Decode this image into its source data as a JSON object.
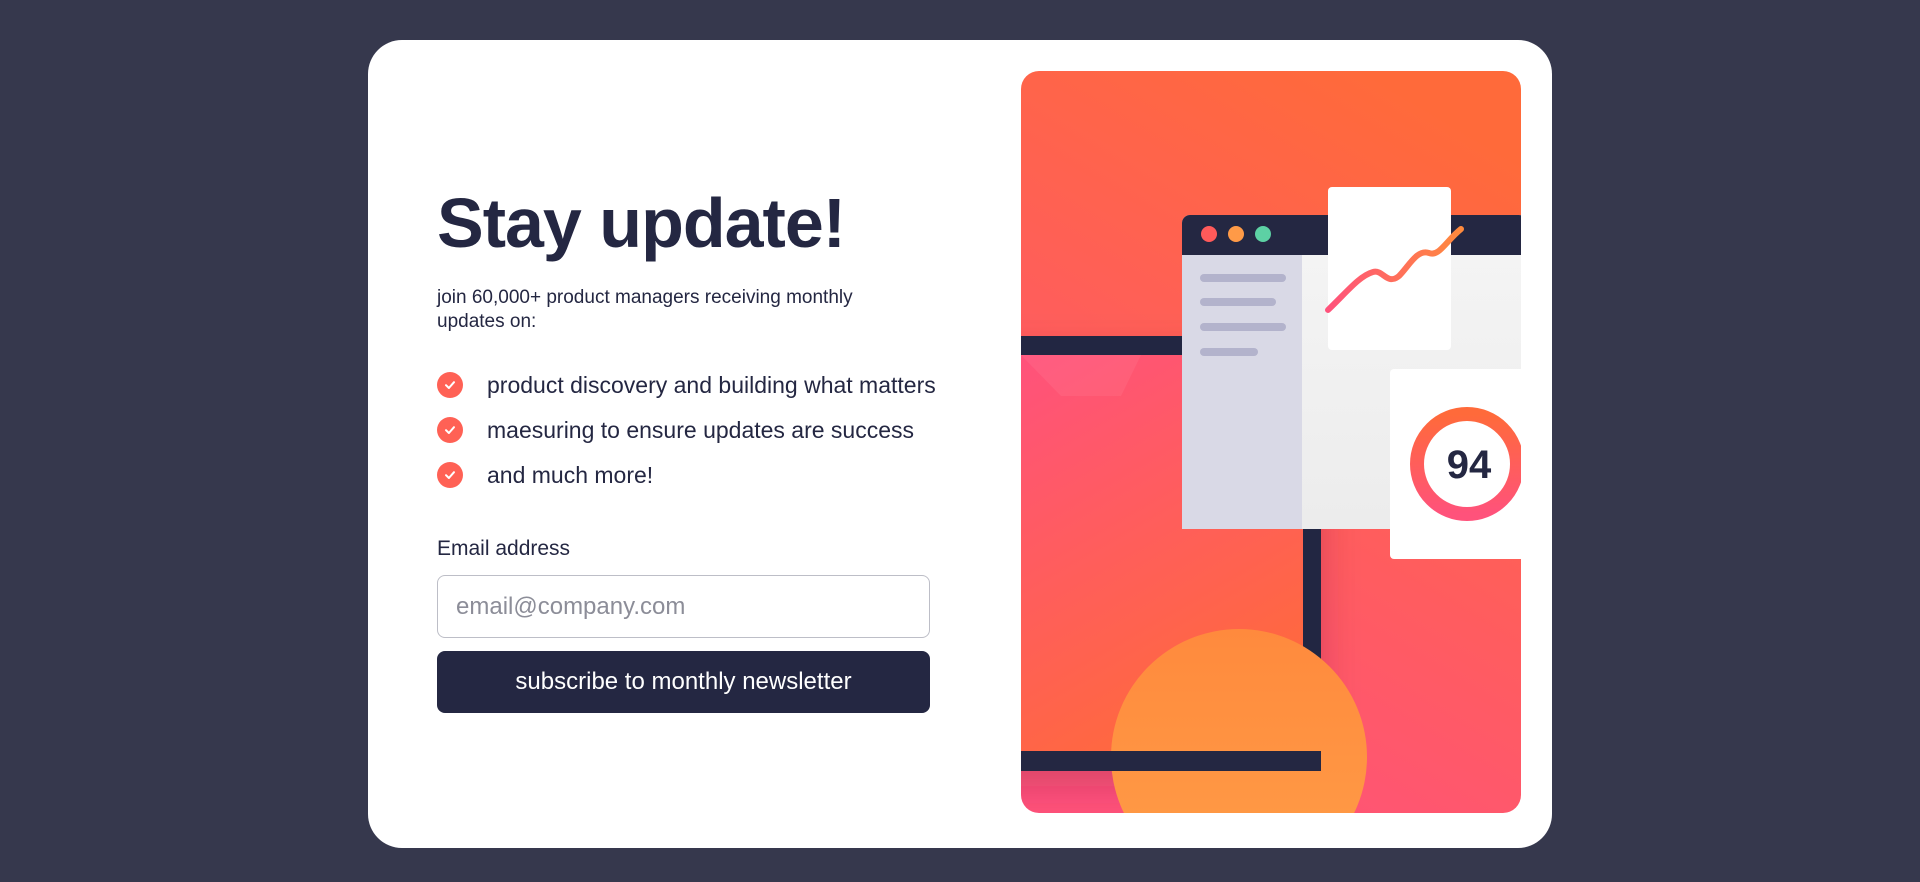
{
  "signup": {
    "title": "Stay update!",
    "subtitle": "join 60,000+ product managers receiving monthly updates on:",
    "benefits": [
      "product discovery and building what matters",
      "maesuring to ensure updates are success",
      "and much more!"
    ],
    "email_label": "Email address",
    "email_placeholder": "email@company.com",
    "email_value": "",
    "button_label": "subscribe to monthly newsletter"
  },
  "illustration": {
    "score": "94",
    "window_dots": [
      "#ff5a5a",
      "#ff9a47",
      "#5dd1a4"
    ]
  },
  "colors": {
    "page_background": "#36384d",
    "card": "#ffffff",
    "text_dark": "#242742",
    "accent": "#ff6155",
    "gradient_top": "#ff6a3a",
    "gradient_bottom": "#ff527b"
  },
  "icons": {
    "benefit_bullet": "check-circle-icon"
  }
}
